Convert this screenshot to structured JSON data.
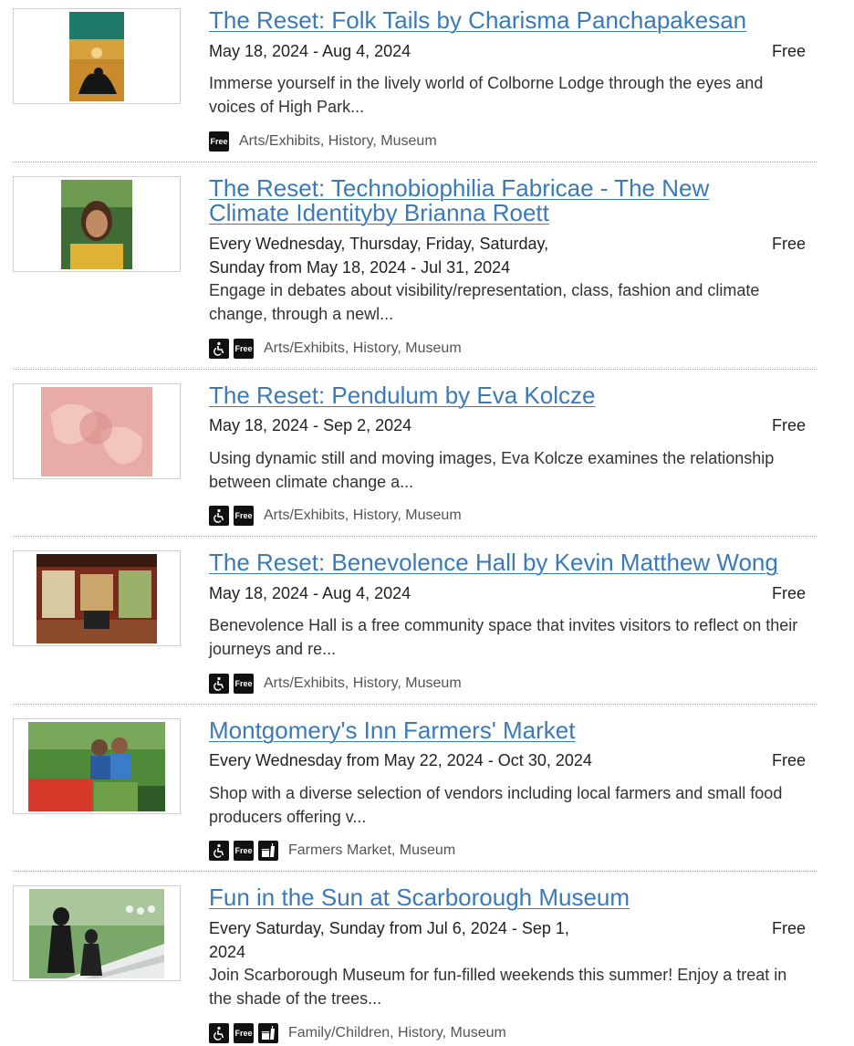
{
  "events": [
    {
      "title": "The Reset: Folk Tails by Charisma Panchapakesan",
      "date": "May 18, 2024 - Aug 4, 2024",
      "price": "Free",
      "description": "Immerse yourself in the lively world of Colborne Lodge through the eyes and voices of High Park...",
      "badges": [
        "free"
      ],
      "free_badge": "Free",
      "categories": "Arts/Exhibits, History, Museum"
    },
    {
      "title": "The Reset: Technobiophilia Fabricae - The New Climate Identityby Brianna Roett",
      "date": "Every Wednesday, Thursday, Friday, Saturday, Sunday from May 18, 2024 - Jul 31, 2024",
      "price": "Free",
      "description": "Engage in debates about visibility/representation, class, fashion and climate change, through a newl...",
      "badges": [
        "accessible",
        "free"
      ],
      "free_badge": "Free",
      "categories": "Arts/Exhibits, History, Museum"
    },
    {
      "title": "The Reset: Pendulum by Eva Kolcze",
      "date": "May 18, 2024 - Sep 2, 2024",
      "price": "Free",
      "description": "Using dynamic still and moving images, Eva Kolcze examines the relationship between climate change a...",
      "badges": [
        "accessible",
        "free"
      ],
      "free_badge": "Free",
      "categories": "Arts/Exhibits, History, Museum"
    },
    {
      "title": "The Reset: Benevolence Hall by Kevin Matthew Wong",
      "date": "May 18, 2024 - Aug 4, 2024",
      "price": "Free",
      "description": "Benevolence Hall is a free community space that invites visitors to reflect on their journeys and re...",
      "badges": [
        "accessible",
        "free"
      ],
      "free_badge": "Free",
      "categories": "Arts/Exhibits, History, Museum"
    },
    {
      "title": "Montgomery's Inn Farmers' Market",
      "date": "Every Wednesday from May 22, 2024 - Oct 30, 2024",
      "price": "Free",
      "description": "Shop with a diverse selection of vendors including local farmers and small food producers offering v...",
      "badges": [
        "accessible",
        "free",
        "food"
      ],
      "free_badge": "Free",
      "categories": "Farmers Market, Museum"
    },
    {
      "title": "Fun in the Sun at Scarborough Museum",
      "date": "Every Saturday, Sunday from Jul 6, 2024 - Sep 1, 2024",
      "price": "Free",
      "description": "Join Scarborough Museum for fun-filled weekends this summer! Enjoy a treat in the shade of the trees...",
      "badges": [
        "accessible",
        "free",
        "food"
      ],
      "free_badge": "Free",
      "categories": "Family/Children, History, Museum"
    }
  ]
}
